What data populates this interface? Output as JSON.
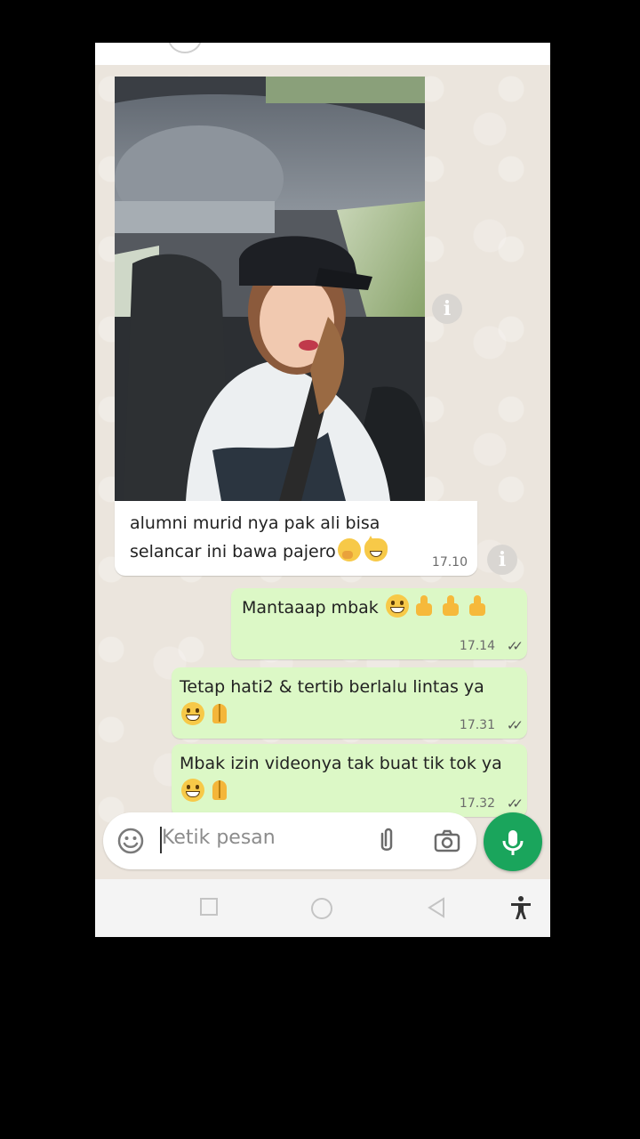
{
  "chat": {
    "incoming": {
      "caption_line1": "alumni murid nya pak ali bisa",
      "caption_line2": "selancar ini bawa pajero",
      "time": "17.10"
    },
    "outgoing": [
      {
        "text": "Mantaaap mbak",
        "time": "17.14",
        "emojis": [
          "grinning-face",
          "thumbs-up",
          "thumbs-up",
          "thumbs-up"
        ]
      },
      {
        "text": "Tetap hati2 & tertib berlalu lintas ya",
        "time": "17.31",
        "emojis": [
          "grinning-face",
          "folded-hands"
        ]
      },
      {
        "text": "Mbak izin videonya tak buat tik tok ya",
        "time": "17.32",
        "emojis": [
          "grinning-face",
          "folded-hands"
        ]
      }
    ],
    "ticks": "✓✓"
  },
  "input": {
    "placeholder": "Ketik pesan"
  },
  "colors": {
    "outgoing_bubble": "#dcf8c6",
    "mic_button": "#1aa55c",
    "chat_background": "#ebe5dd"
  },
  "icons": [
    "sticker-icon",
    "attach-icon",
    "camera-icon",
    "mic-icon",
    "info-icon",
    "recent-apps-icon",
    "home-icon",
    "back-icon",
    "accessibility-icon"
  ]
}
